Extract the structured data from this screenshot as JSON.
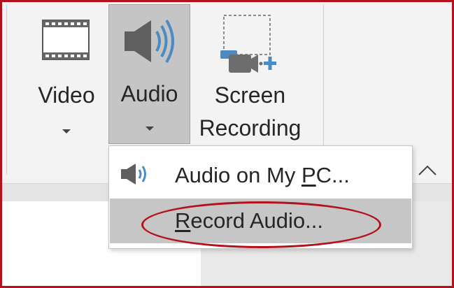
{
  "ribbon": {
    "buttons": [
      {
        "label": "Video",
        "icon": "film-strip-icon"
      },
      {
        "label": "Audio",
        "icon": "speaker-icon"
      },
      {
        "label_line1": "Screen",
        "label_line2": "Recording",
        "icon": "screen-recording-icon"
      }
    ]
  },
  "audio_menu": {
    "items": [
      {
        "label_pre": "Audio on My ",
        "label_accel": "P",
        "label_post": "C...",
        "icon": "speaker-icon",
        "selected": false
      },
      {
        "label_pre": "",
        "label_accel": "R",
        "label_post": "ecord Audio...",
        "selected": true
      }
    ]
  },
  "colors": {
    "annotation": "#b3121d",
    "accent": "#4a8bc4",
    "selected_bg": "#c6c6c6"
  }
}
